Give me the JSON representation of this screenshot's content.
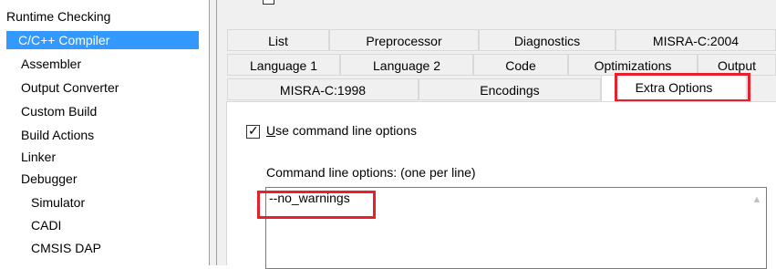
{
  "categories": [
    {
      "label": "Runtime Checking"
    },
    {
      "label": "C/C++ Compiler"
    },
    {
      "label": "Assembler"
    },
    {
      "label": "Output Converter"
    },
    {
      "label": "Custom Build"
    },
    {
      "label": "Build Actions"
    },
    {
      "label": "Linker"
    },
    {
      "label": "Debugger"
    },
    {
      "label": "Simulator"
    },
    {
      "label": "CADI"
    },
    {
      "label": "CMSIS DAP"
    }
  ],
  "tabs": {
    "row1": [
      "List",
      "Preprocessor",
      "Diagnostics",
      "MISRA-C:2004"
    ],
    "row2": [
      "Language 1",
      "Language 2",
      "Code",
      "Optimizations",
      "Output"
    ],
    "row3": [
      "MISRA-C:1998",
      "Encodings",
      "Extra Options"
    ]
  },
  "options": {
    "use_cmdline_label_underlined": "U",
    "use_cmdline_label_rest": "se command line options",
    "use_cmdline_checked": true,
    "cmdline_label": "Command line options:  (one per line)",
    "cmdline_value": "--no_warnings"
  },
  "colors": {
    "selection": "#3399ff",
    "highlight": "#e8202b",
    "panel": "#f0f0f0"
  },
  "icons": {
    "scroll_up": "chevron-up-icon",
    "checkmark": "checkmark-icon"
  }
}
